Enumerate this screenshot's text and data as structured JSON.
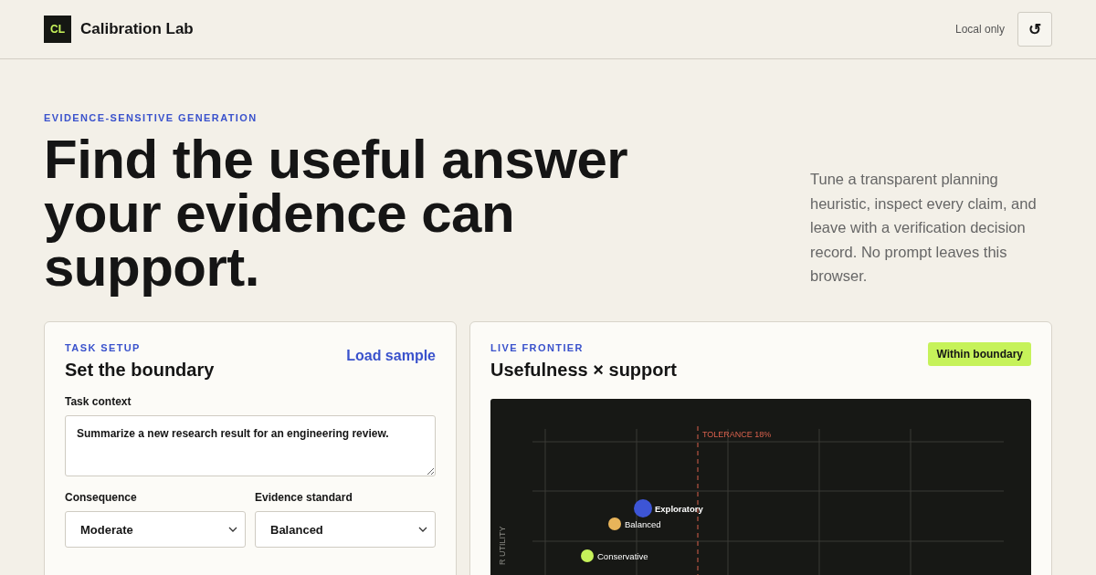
{
  "header": {
    "logo": "CL",
    "title": "Calibration Lab",
    "status": "Local only",
    "reset_icon": "↺"
  },
  "hero": {
    "eyebrow": "EVIDENCE-SENSITIVE GENERATION",
    "title": "Find the useful answer your evidence can support.",
    "description": "Tune a transparent planning heuristic, inspect every claim, and leave with a verification decision record. No prompt leaves this browser."
  },
  "task_setup": {
    "eyebrow": "TASK SETUP",
    "title": "Set the boundary",
    "action": "Load sample",
    "context_label": "Task context",
    "context_value": "Summarize a new research result for an engineering review.",
    "selects": [
      {
        "label": "Consequence",
        "value": "Moderate"
      },
      {
        "label": "Evidence standard",
        "value": "Balanced"
      }
    ]
  },
  "frontier": {
    "eyebrow": "LIVE FRONTIER",
    "title": "Usefulness × support",
    "badge": "Within boundary",
    "tolerance_label": "TOLERANCE 18%",
    "y_axis_label": "R UTILITY",
    "points": [
      {
        "label": "Exploratory",
        "color": "#3d55d6",
        "selected": true
      },
      {
        "label": "Balanced",
        "color": "#e8b45a",
        "selected": false
      },
      {
        "label": "Conservative",
        "color": "#c6f25a",
        "selected": false
      }
    ]
  }
}
